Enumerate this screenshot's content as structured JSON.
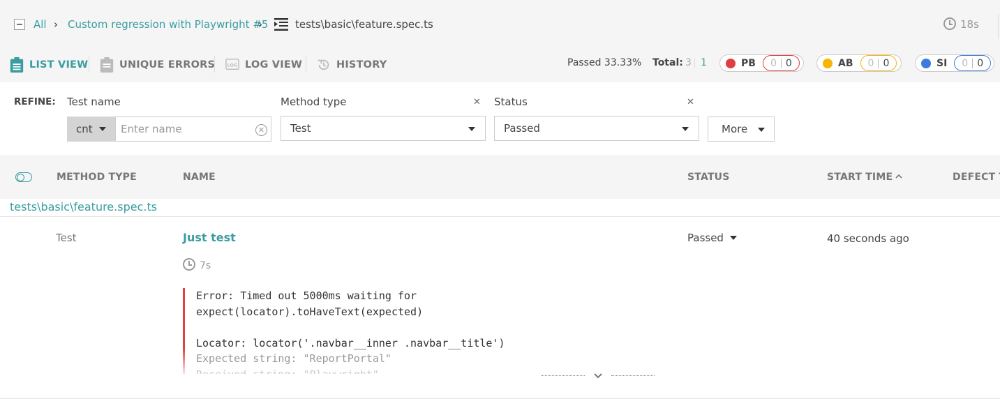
{
  "breadcrumb": {
    "all": "All",
    "launch": "Custom regression with Playwright #5",
    "item": "tests\\basic\\feature.spec.ts",
    "duration": "18s"
  },
  "tabs": [
    {
      "label": "LIST VIEW",
      "active": true,
      "icon": "clipboard-icon"
    },
    {
      "label": "UNIQUE ERRORS",
      "active": false,
      "icon": "clipboard-icon"
    },
    {
      "label": "LOG VIEW",
      "active": false,
      "icon": "log-icon"
    },
    {
      "label": "HISTORY",
      "active": false,
      "icon": "history-icon"
    }
  ],
  "stats": {
    "passed": "Passed 33.33%",
    "total_label": "Total:",
    "total_value": "3",
    "total_selected": "1"
  },
  "badges": [
    {
      "label": "PB",
      "color": "#e03f3f",
      "count1": "0",
      "count2": "0"
    },
    {
      "label": "AB",
      "color": "#f7b500",
      "count1": "0",
      "count2": "0"
    },
    {
      "label": "SI",
      "color": "#3c7bde",
      "count1": "0",
      "count2": "0"
    }
  ],
  "refine": {
    "label": "REFINE:",
    "test_name_label": "Test name",
    "condition": "cnt",
    "name_placeholder": "Enter name",
    "method_type_label": "Method type",
    "method_type_value": "Test",
    "status_label": "Status",
    "status_value": "Passed",
    "more_label": "More"
  },
  "table": {
    "columns": [
      "METHOD TYPE",
      "NAME",
      "STATUS",
      "START TIME",
      "DEFECT TY"
    ],
    "suite_path": "tests\\basic\\feature.spec.ts",
    "rows": [
      {
        "method_type": "Test",
        "name": "Just test",
        "duration": "7s",
        "status": "Passed",
        "start_time": "40 seconds ago",
        "error_lines": [
          "Error: Timed out 5000ms waiting for",
          "expect(locator).toHaveText(expected)",
          "",
          "Locator: locator('.navbar__inner .navbar__title')",
          "Expected string: \"ReportPortal\"",
          "Received string: \"Playwright\""
        ]
      }
    ]
  },
  "colors": {
    "accent": "#3a9da0",
    "error_bar": "#e03f3f"
  }
}
